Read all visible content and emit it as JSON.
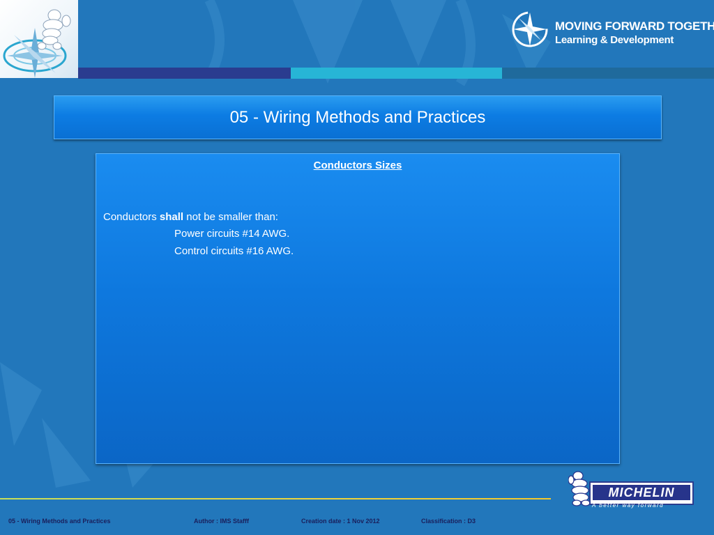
{
  "header": {
    "brand_line1": "MOVING FORWARD TOGETHER",
    "brand_line2": "Learning & Development"
  },
  "slide": {
    "title": "05 - Wiring Methods and Practices",
    "heading": "Conductors Sizes",
    "line1_prefix": "Conductors ",
    "line1_bold": "shall",
    "line1_suffix": " not be smaller than:",
    "line2": "Power circuits  #14 AWG.",
    "line3": "Control circuits #16 AWG."
  },
  "logo": {
    "wordmark": "MICHELIN",
    "tagline": "A better way forward"
  },
  "footer": {
    "title": "05 - Wiring Methods and Practices",
    "author": "Author : IMS Stafff",
    "created": "Creation date : 1 Nov 2012",
    "classification": "Classification : D3"
  },
  "colors": {
    "background": "#2277bb",
    "stripe_dark": "#2a3c8f",
    "stripe_light": "#27b5d6",
    "stripe_mid": "#1f6a9c",
    "panel_blue": "#0e78de",
    "footer_text": "#1a1f5c",
    "rule_yellow": "#f0d43a"
  },
  "icons": [
    "compass-star-icon",
    "brand-star-icon",
    "michelin-man-icon"
  ]
}
